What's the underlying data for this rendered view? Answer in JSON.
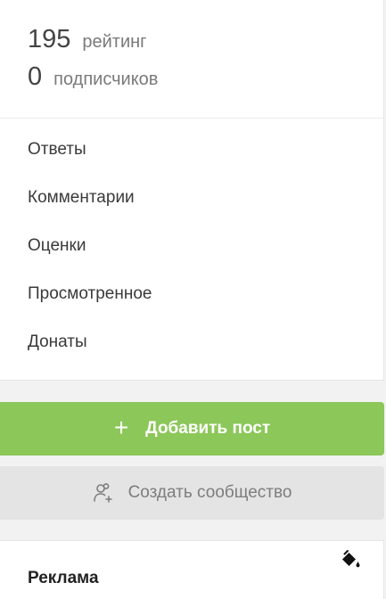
{
  "stats": {
    "rating_value": "195",
    "rating_label": "рейтинг",
    "subscribers_value": "0",
    "subscribers_label": "подписчиков"
  },
  "menu": {
    "items": [
      {
        "label": "Ответы"
      },
      {
        "label": "Комментарии"
      },
      {
        "label": "Оценки"
      },
      {
        "label": "Просмотренное"
      },
      {
        "label": "Донаты"
      }
    ]
  },
  "add_post": {
    "label": "Добавить пост",
    "icon": "plus-icon"
  },
  "create_community": {
    "label": "Создать сообщество",
    "icon": "add-user-icon"
  },
  "ad": {
    "title": "Реклама",
    "icon": "paint-bucket-icon"
  },
  "colors": {
    "accent_green": "#8cc759",
    "secondary_button": "#e4e4e4",
    "background": "#f2f2f2"
  }
}
